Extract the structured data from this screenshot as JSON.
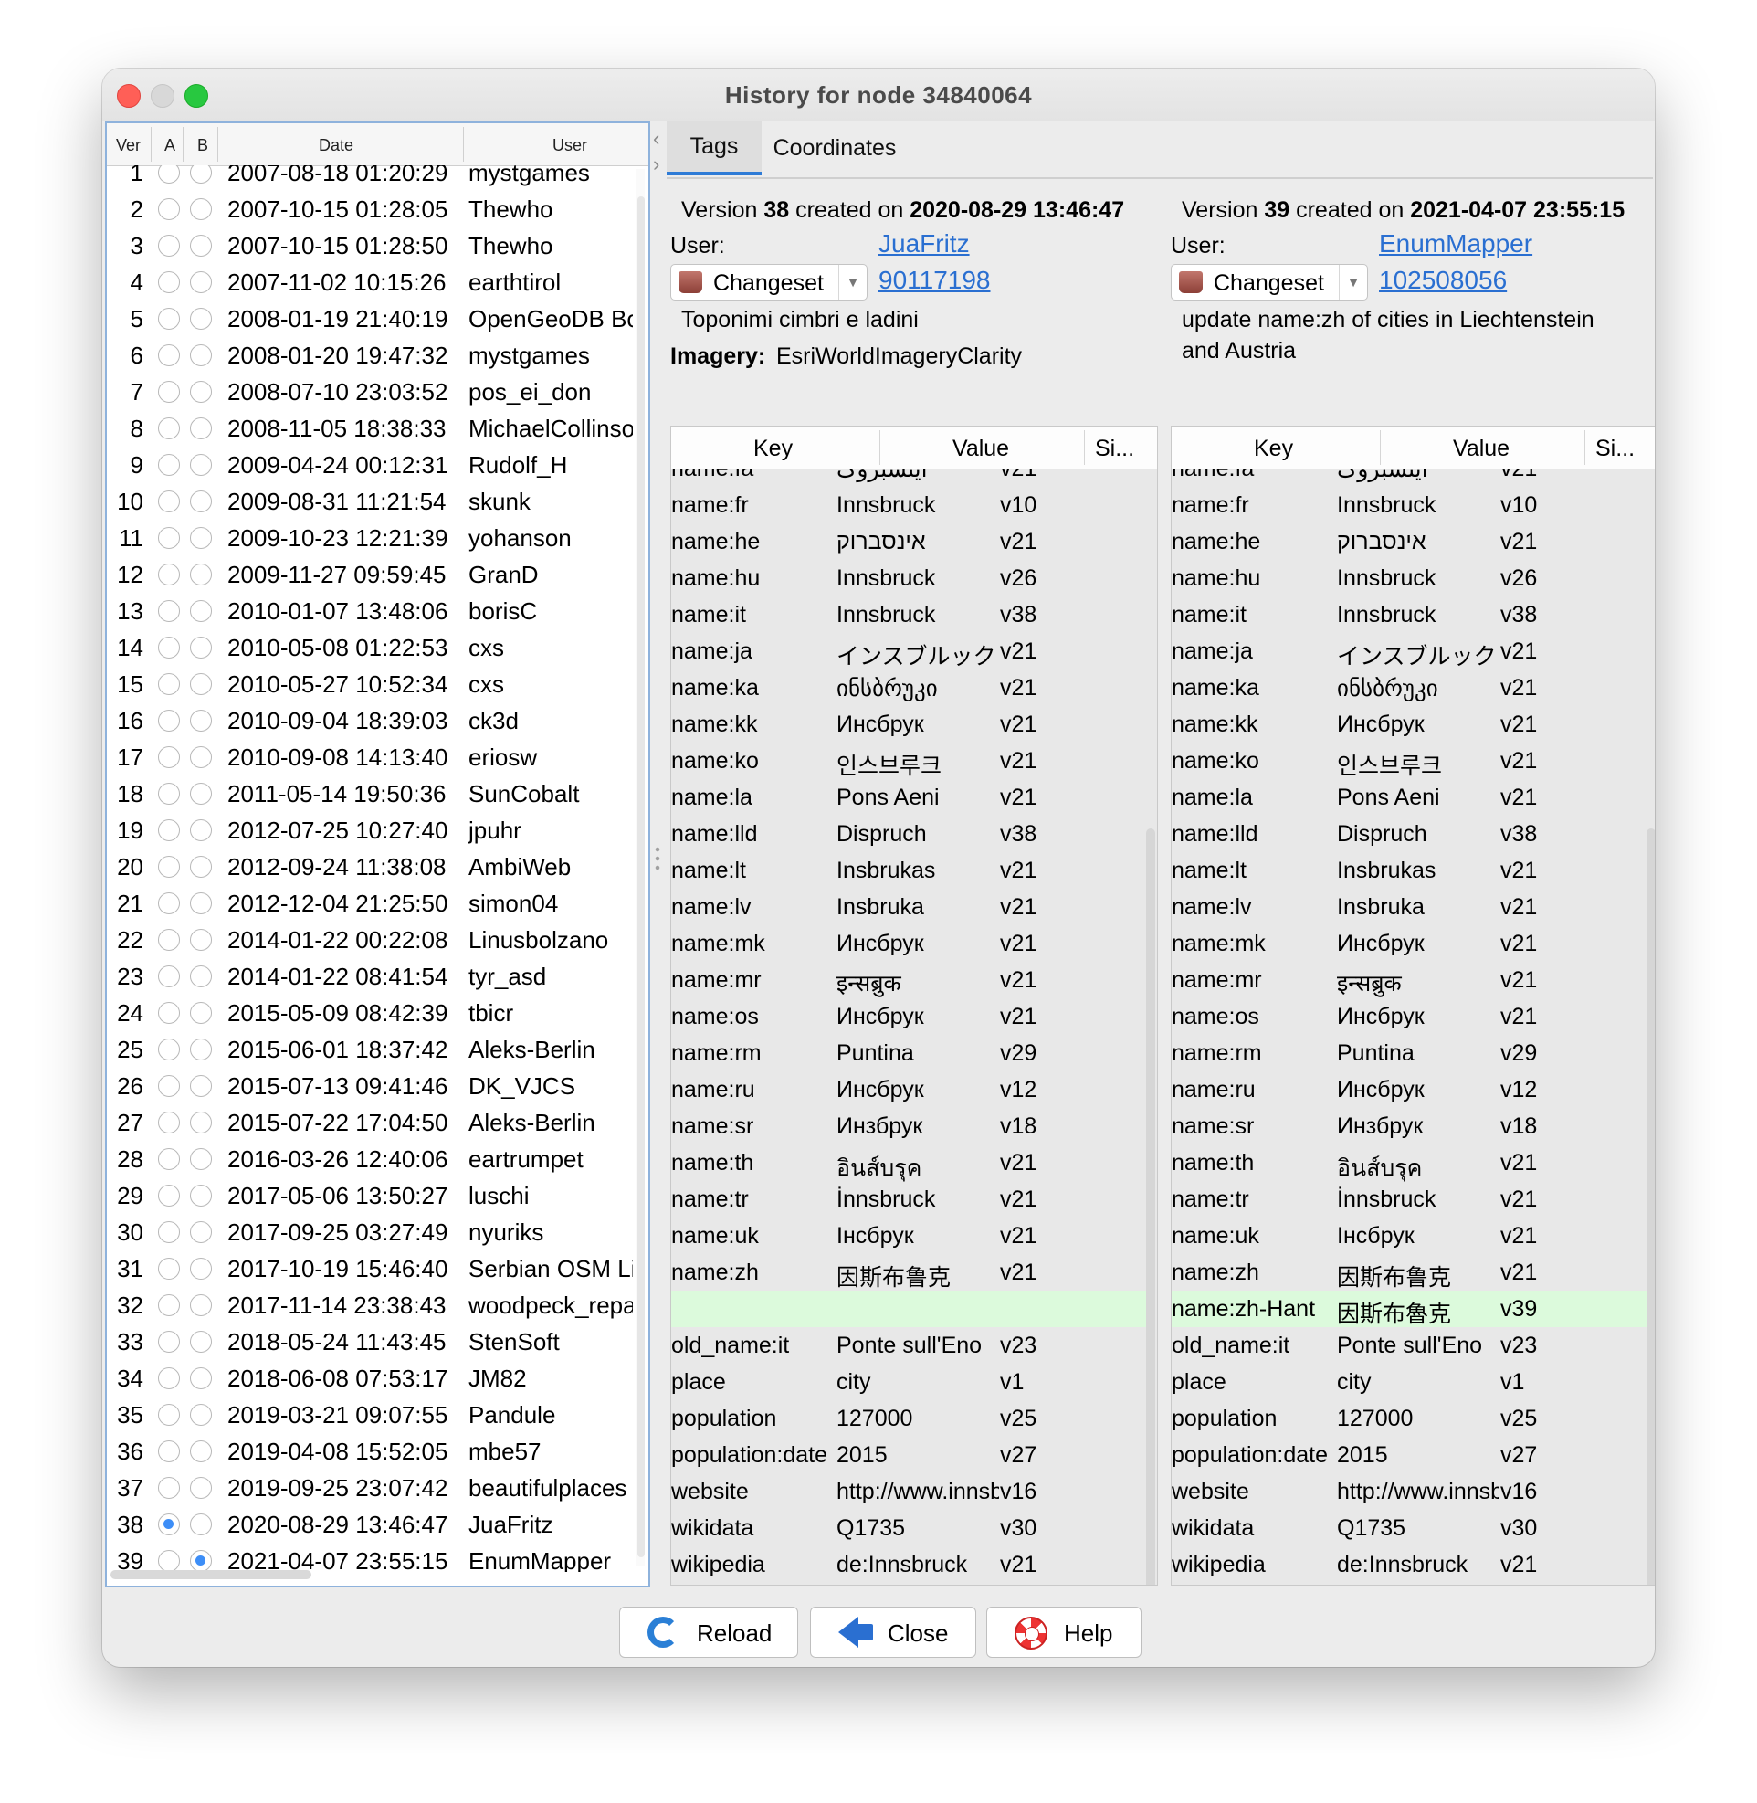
{
  "window": {
    "title": "History for node 34840064"
  },
  "history": {
    "headers": {
      "ver": "Ver",
      "a": "A",
      "b": "B",
      "date": "Date",
      "user": "User"
    },
    "rows": [
      {
        "ver": "1",
        "date": "2007-08-18 01:20:29",
        "user": "mystgames",
        "a": false,
        "b": false
      },
      {
        "ver": "2",
        "date": "2007-10-15 01:28:05",
        "user": "Thewho",
        "a": false,
        "b": false
      },
      {
        "ver": "3",
        "date": "2007-10-15 01:28:50",
        "user": "Thewho",
        "a": false,
        "b": false
      },
      {
        "ver": "4",
        "date": "2007-11-02 10:15:26",
        "user": "earthtirol",
        "a": false,
        "b": false
      },
      {
        "ver": "5",
        "date": "2008-01-19 21:40:19",
        "user": "OpenGeoDB Bot",
        "a": false,
        "b": false
      },
      {
        "ver": "6",
        "date": "2008-01-20 19:47:32",
        "user": "mystgames",
        "a": false,
        "b": false
      },
      {
        "ver": "7",
        "date": "2008-07-10 23:03:52",
        "user": "pos_ei_don",
        "a": false,
        "b": false
      },
      {
        "ver": "8",
        "date": "2008-11-05 18:38:33",
        "user": "MichaelCollinson",
        "a": false,
        "b": false
      },
      {
        "ver": "9",
        "date": "2009-04-24 00:12:31",
        "user": "Rudolf_H",
        "a": false,
        "b": false
      },
      {
        "ver": "10",
        "date": "2009-08-31 11:21:54",
        "user": "skunk",
        "a": false,
        "b": false
      },
      {
        "ver": "11",
        "date": "2009-10-23 12:21:39",
        "user": "yohanson",
        "a": false,
        "b": false
      },
      {
        "ver": "12",
        "date": "2009-11-27 09:59:45",
        "user": "GranD",
        "a": false,
        "b": false
      },
      {
        "ver": "13",
        "date": "2010-01-07 13:48:06",
        "user": "borisC",
        "a": false,
        "b": false
      },
      {
        "ver": "14",
        "date": "2010-05-08 01:22:53",
        "user": "cxs",
        "a": false,
        "b": false
      },
      {
        "ver": "15",
        "date": "2010-05-27 10:52:34",
        "user": "cxs",
        "a": false,
        "b": false
      },
      {
        "ver": "16",
        "date": "2010-09-04 18:39:03",
        "user": "ck3d",
        "a": false,
        "b": false
      },
      {
        "ver": "17",
        "date": "2010-09-08 14:13:40",
        "user": "eriosw",
        "a": false,
        "b": false
      },
      {
        "ver": "18",
        "date": "2011-05-14 19:50:36",
        "user": "SunCobalt",
        "a": false,
        "b": false
      },
      {
        "ver": "19",
        "date": "2012-07-25 10:27:40",
        "user": "jpuhr",
        "a": false,
        "b": false
      },
      {
        "ver": "20",
        "date": "2012-09-24 11:38:08",
        "user": "AmbiWeb",
        "a": false,
        "b": false
      },
      {
        "ver": "21",
        "date": "2012-12-04 21:25:50",
        "user": "simon04",
        "a": false,
        "b": false
      },
      {
        "ver": "22",
        "date": "2014-01-22 00:22:08",
        "user": "Linusbolzano",
        "a": false,
        "b": false
      },
      {
        "ver": "23",
        "date": "2014-01-22 08:41:54",
        "user": "tyr_asd",
        "a": false,
        "b": false
      },
      {
        "ver": "24",
        "date": "2015-05-09 08:42:39",
        "user": "tbicr",
        "a": false,
        "b": false
      },
      {
        "ver": "25",
        "date": "2015-06-01 18:37:42",
        "user": "Aleks-Berlin",
        "a": false,
        "b": false
      },
      {
        "ver": "26",
        "date": "2015-07-13 09:41:46",
        "user": "DK_VJCS",
        "a": false,
        "b": false
      },
      {
        "ver": "27",
        "date": "2015-07-22 17:04:50",
        "user": "Aleks-Berlin",
        "a": false,
        "b": false
      },
      {
        "ver": "28",
        "date": "2016-03-26 12:40:06",
        "user": "eartrumpet",
        "a": false,
        "b": false
      },
      {
        "ver": "29",
        "date": "2017-05-06 13:50:27",
        "user": "luschi",
        "a": false,
        "b": false
      },
      {
        "ver": "30",
        "date": "2017-09-25 03:27:49",
        "user": "nyuriks",
        "a": false,
        "b": false
      },
      {
        "ver": "31",
        "date": "2017-10-19 15:46:40",
        "user": "Serbian OSM Lint",
        "a": false,
        "b": false
      },
      {
        "ver": "32",
        "date": "2017-11-14 23:38:43",
        "user": "woodpeck_repair",
        "a": false,
        "b": false
      },
      {
        "ver": "33",
        "date": "2018-05-24 11:43:45",
        "user": "StenSoft",
        "a": false,
        "b": false
      },
      {
        "ver": "34",
        "date": "2018-06-08 07:53:17",
        "user": "JM82",
        "a": false,
        "b": false
      },
      {
        "ver": "35",
        "date": "2019-03-21 09:07:55",
        "user": "Pandule",
        "a": false,
        "b": false
      },
      {
        "ver": "36",
        "date": "2019-04-08 15:52:05",
        "user": "mbe57",
        "a": false,
        "b": false
      },
      {
        "ver": "37",
        "date": "2019-09-25 23:07:42",
        "user": "beautifulplaces",
        "a": false,
        "b": false
      },
      {
        "ver": "38",
        "date": "2020-08-29 13:46:47",
        "user": "JuaFritz",
        "a": true,
        "b": false
      },
      {
        "ver": "39",
        "date": "2021-04-07 23:55:15",
        "user": "EnumMapper",
        "a": false,
        "b": true
      }
    ]
  },
  "tabs": [
    "Tags",
    "Coordinates"
  ],
  "left_version": {
    "prefix": "Version",
    "num": "38",
    "mid": "created on",
    "date": "2020-08-29 13:46:47",
    "user_label": "User:",
    "user": "JuaFritz",
    "changeset_label": "Changeset",
    "changeset": "90117198",
    "comment": "Toponimi cimbri e ladini",
    "imagery_label": "Imagery",
    "imagery": "EsriWorldImageryClarity"
  },
  "right_version": {
    "prefix": "Version",
    "num": "39",
    "mid": "created on",
    "date": "2021-04-07 23:55:15",
    "user_label": "User:",
    "user": "EnumMapper",
    "changeset_label": "Changeset",
    "changeset": "102508056",
    "comment_line1": "update name:zh of cities in Liechtenstein",
    "comment_line2": "and Austria"
  },
  "tag_headers": {
    "key": "Key",
    "value": "Value",
    "since": "Si..."
  },
  "left_tags": [
    {
      "k": "name:fa",
      "v": "اینسبروک",
      "s": "v21"
    },
    {
      "k": "name:fr",
      "v": "Innsbruck",
      "s": "v10"
    },
    {
      "k": "name:he",
      "v": "אינסברוק",
      "s": "v21"
    },
    {
      "k": "name:hu",
      "v": "Innsbruck",
      "s": "v26"
    },
    {
      "k": "name:it",
      "v": "Innsbruck",
      "s": "v38"
    },
    {
      "k": "name:ja",
      "v": "インスブルック",
      "s": "v21"
    },
    {
      "k": "name:ka",
      "v": "ინსბრუკი",
      "s": "v21"
    },
    {
      "k": "name:kk",
      "v": "Инсбрук",
      "s": "v21"
    },
    {
      "k": "name:ko",
      "v": "인스브루크",
      "s": "v21"
    },
    {
      "k": "name:la",
      "v": "Pons Aeni",
      "s": "v21"
    },
    {
      "k": "name:lld",
      "v": "Dispruch",
      "s": "v38"
    },
    {
      "k": "name:lt",
      "v": "Insbrukas",
      "s": "v21"
    },
    {
      "k": "name:lv",
      "v": "Insbruka",
      "s": "v21"
    },
    {
      "k": "name:mk",
      "v": "Инсбрук",
      "s": "v21"
    },
    {
      "k": "name:mr",
      "v": "इन्सब्रुक",
      "s": "v21"
    },
    {
      "k": "name:os",
      "v": "Инсбрук",
      "s": "v21"
    },
    {
      "k": "name:rm",
      "v": "Puntina",
      "s": "v29"
    },
    {
      "k": "name:ru",
      "v": "Инсбрук",
      "s": "v12"
    },
    {
      "k": "name:sr",
      "v": "Инзбрук",
      "s": "v18"
    },
    {
      "k": "name:th",
      "v": "อินส์บรุค",
      "s": "v21"
    },
    {
      "k": "name:tr",
      "v": "İnnsbruck",
      "s": "v21"
    },
    {
      "k": "name:uk",
      "v": "Інсбрук",
      "s": "v21"
    },
    {
      "k": "name:zh",
      "v": "因斯布鲁克",
      "s": "v21"
    },
    {
      "k": "",
      "v": "",
      "s": "",
      "state": "blank"
    },
    {
      "k": "old_name:it",
      "v": "Ponte sull'Eno",
      "s": "v23"
    },
    {
      "k": "place",
      "v": "city",
      "s": "v1"
    },
    {
      "k": "population",
      "v": "127000",
      "s": "v25"
    },
    {
      "k": "population:date",
      "v": "2015",
      "s": "v27"
    },
    {
      "k": "website",
      "v": "http://www.innsb...",
      "s": "v16"
    },
    {
      "k": "wikidata",
      "v": "Q1735",
      "s": "v30"
    },
    {
      "k": "wikipedia",
      "v": "de:Innsbruck",
      "s": "v21"
    }
  ],
  "right_tags": [
    {
      "k": "name:fa",
      "v": "اینسبروک",
      "s": "v21"
    },
    {
      "k": "name:fr",
      "v": "Innsbruck",
      "s": "v10"
    },
    {
      "k": "name:he",
      "v": "אינסברוק",
      "s": "v21"
    },
    {
      "k": "name:hu",
      "v": "Innsbruck",
      "s": "v26"
    },
    {
      "k": "name:it",
      "v": "Innsbruck",
      "s": "v38"
    },
    {
      "k": "name:ja",
      "v": "インスブルック",
      "s": "v21"
    },
    {
      "k": "name:ka",
      "v": "ინსბრუკი",
      "s": "v21"
    },
    {
      "k": "name:kk",
      "v": "Инсбрук",
      "s": "v21"
    },
    {
      "k": "name:ko",
      "v": "인스브루크",
      "s": "v21"
    },
    {
      "k": "name:la",
      "v": "Pons Aeni",
      "s": "v21"
    },
    {
      "k": "name:lld",
      "v": "Dispruch",
      "s": "v38"
    },
    {
      "k": "name:lt",
      "v": "Insbrukas",
      "s": "v21"
    },
    {
      "k": "name:lv",
      "v": "Insbruka",
      "s": "v21"
    },
    {
      "k": "name:mk",
      "v": "Инсбрук",
      "s": "v21"
    },
    {
      "k": "name:mr",
      "v": "इन्सब्रुक",
      "s": "v21"
    },
    {
      "k": "name:os",
      "v": "Инсбрук",
      "s": "v21"
    },
    {
      "k": "name:rm",
      "v": "Puntina",
      "s": "v29"
    },
    {
      "k": "name:ru",
      "v": "Инсбрук",
      "s": "v12"
    },
    {
      "k": "name:sr",
      "v": "Инзбрук",
      "s": "v18"
    },
    {
      "k": "name:th",
      "v": "อินส์บรุค",
      "s": "v21"
    },
    {
      "k": "name:tr",
      "v": "İnnsbruck",
      "s": "v21"
    },
    {
      "k": "name:uk",
      "v": "Інсбрук",
      "s": "v21"
    },
    {
      "k": "name:zh",
      "v": "因斯布鲁克",
      "s": "v21"
    },
    {
      "k": "name:zh-Hant",
      "v": "因斯布魯克",
      "s": "v39",
      "state": "added"
    },
    {
      "k": "old_name:it",
      "v": "Ponte sull'Eno",
      "s": "v23"
    },
    {
      "k": "place",
      "v": "city",
      "s": "v1"
    },
    {
      "k": "population",
      "v": "127000",
      "s": "v25"
    },
    {
      "k": "population:date",
      "v": "2015",
      "s": "v27"
    },
    {
      "k": "website",
      "v": "http://www.innsb...",
      "s": "v16"
    },
    {
      "k": "wikidata",
      "v": "Q1735",
      "s": "v30"
    },
    {
      "k": "wikipedia",
      "v": "de:Innsbruck",
      "s": "v21"
    }
  ],
  "buttons": {
    "reload": "Reload",
    "close": "Close",
    "help": "Help"
  },
  "colors": {
    "selection_blue": "#3d8ef7",
    "link_blue": "#2a6fd1",
    "added_green": "#dcfadc",
    "accent": "#2e7bd6"
  },
  "icons": {
    "reload": "reload-icon",
    "close": "close-icon",
    "help": "help-icon",
    "changeset": "changeset-icon"
  }
}
